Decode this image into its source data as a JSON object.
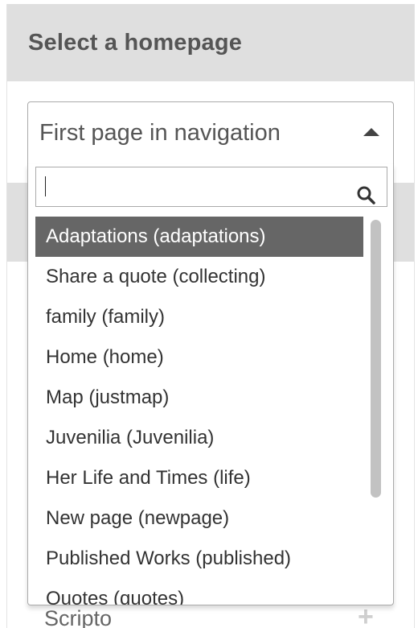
{
  "panel": {
    "title": "Select a homepage",
    "behind_row_label": "Scripto",
    "behind_row_action": "+"
  },
  "select": {
    "value": "First page in navigation",
    "arrow_icon": "triangle-up-icon"
  },
  "search": {
    "value": "",
    "icon": "search-icon"
  },
  "options": [
    "Adaptations (adaptations)",
    "Share a quote (collecting)",
    "family (family)",
    "Home (home)",
    "Map (justmap)",
    "Juvenilia (Juvenilia)",
    "Her Life and Times (life)",
    "New page (newpage)",
    "Published Works (published)",
    "Quotes (quotes)"
  ],
  "highlighted_index": 0,
  "colors": {
    "header_bg": "#dfdfdf",
    "highlight_bg": "#666666",
    "highlight_text": "#ffffff",
    "text": "#333333",
    "scrollbar_thumb": "#c2c2c2"
  }
}
